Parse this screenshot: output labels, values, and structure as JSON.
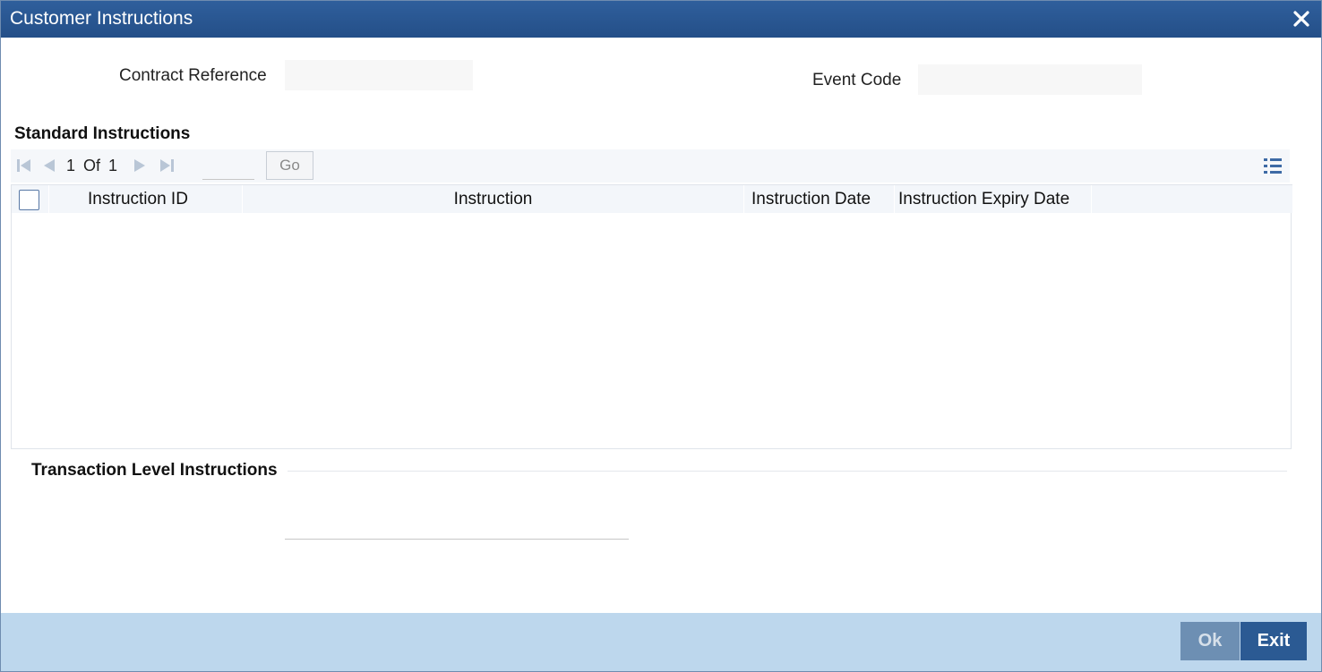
{
  "window": {
    "title": "Customer Instructions"
  },
  "header": {
    "contract_reference_label": "Contract Reference",
    "contract_reference_value": "",
    "event_code_label": "Event Code",
    "event_code_value": ""
  },
  "standard_instructions": {
    "title": "Standard Instructions",
    "pager": {
      "current_page": "1",
      "of_label": "Of",
      "total_pages": "1",
      "page_input": "",
      "go_label": "Go"
    },
    "columns": [
      "Instruction ID",
      "Instruction",
      "Instruction Date",
      "Instruction Expiry Date"
    ],
    "rows": []
  },
  "transaction_level": {
    "title": "Transaction Level Instructions",
    "value": ""
  },
  "footer": {
    "ok_label": "Ok",
    "exit_label": "Exit"
  },
  "colors": {
    "titlebar": "#2a5690",
    "footer": "#bdd7ed",
    "exit_button": "#2b5a93",
    "ok_button": "#6d8fb3"
  },
  "icons": [
    "close-icon",
    "first-page-icon",
    "previous-page-icon",
    "next-page-icon",
    "last-page-icon",
    "list-view-icon"
  ]
}
